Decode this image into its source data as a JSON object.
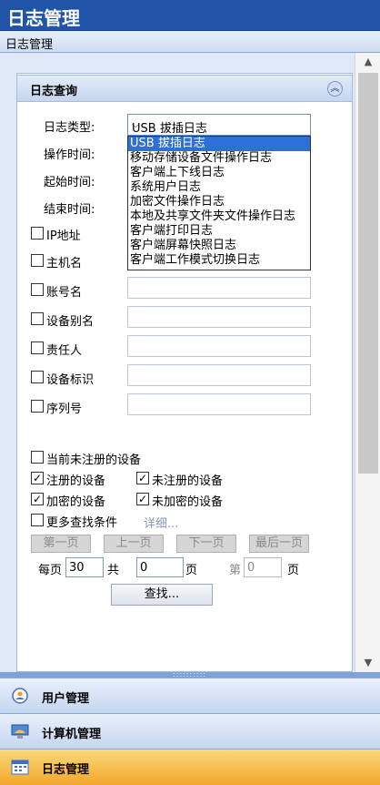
{
  "window": {
    "title": "日志管理"
  },
  "subheader": {
    "label": "日志管理"
  },
  "section": {
    "title": "日志查询"
  },
  "form": {
    "log_type_label": "日志类型:",
    "log_type_value": "USB 拔插日志",
    "op_time_label": "操作时间:",
    "start_time_label": "起始时间:",
    "end_time_label": "结束时间:",
    "ip_label": "IP地址",
    "host_label": "主机名",
    "account_label": "账号名",
    "device_alias_label": "设备别名",
    "owner_label": "责任人",
    "device_id_label": "设备标识",
    "serial_label": "序列号"
  },
  "dropdown": {
    "options": [
      "USB 拔插日志",
      "移动存储设备文件操作日志",
      "客户端上下线日志",
      "系统用户日志",
      "加密文件操作日志",
      "本地及共享文件夹文件操作日志",
      "客户端打印日志",
      "客户端屏幕快照日志",
      "客户端工作模式切换日志"
    ]
  },
  "filters": {
    "unregistered_current": {
      "label": "当前未注册的设备",
      "checked": false
    },
    "registered": {
      "label": "注册的设备",
      "checked": true
    },
    "unregistered": {
      "label": "未注册的设备",
      "checked": true
    },
    "encrypted": {
      "label": "加密的设备",
      "checked": true
    },
    "unencrypted": {
      "label": "未加密的设备",
      "checked": true
    },
    "more_conditions": {
      "label": "更多查找条件",
      "checked": false
    },
    "details_link": "详细..."
  },
  "paging": {
    "first": "第一页",
    "prev": "上一页",
    "next": "下一页",
    "last": "最后一页",
    "per_page_label": "每页",
    "per_page_value": "30",
    "total_label": "共",
    "total_value": "0",
    "pages_unit": "页",
    "page_label": "第",
    "page_value": "0",
    "page_unit": "页"
  },
  "search_button": "查找...",
  "nav": {
    "users": "用户管理",
    "computers": "计算机管理",
    "logs": "日志管理"
  },
  "colors": {
    "title_bg": "#1f54a8",
    "panel_bg": "#dfe8f6",
    "active_nav": "#f2a72c",
    "selection": "#2f6fd6"
  }
}
